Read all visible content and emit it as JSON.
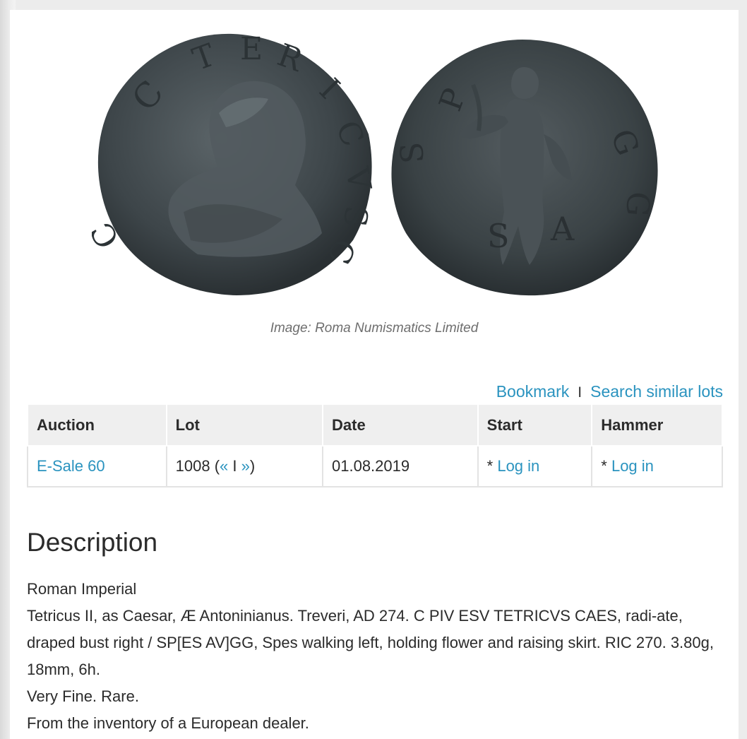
{
  "image": {
    "caption": "Image: Roma Numismatics Limited",
    "obverse_icon": "coin-obverse-bust",
    "reverse_icon": "coin-reverse-spes"
  },
  "actions": {
    "bookmark_label": "Bookmark",
    "separator": "I",
    "search_similar_label": "Search similar lots"
  },
  "table": {
    "headers": [
      "Auction",
      "Lot",
      "Date",
      "Start",
      "Hammer"
    ],
    "row": {
      "auction": "E-Sale 60",
      "lot_number": "1008",
      "lot_prev": "«",
      "lot_sep": "I",
      "lot_next": "»",
      "date": "01.08.2019",
      "start_prefix": "* ",
      "start_link": "Log in",
      "hammer_prefix": "* ",
      "hammer_link": "Log in"
    }
  },
  "description": {
    "title": "Description",
    "lines": [
      "Roman Imperial",
      "Tetricus II, as Caesar, Æ Antoninianus. Treveri, AD 274. C PIV ESV TETRICVS CAES, radi-ate, draped bust right / SP[ES AV]GG, Spes walking left, holding flower and raising skirt. RIC 270. 3.80g, 18mm, 6h.",
      "Very Fine. Rare.",
      "From the inventory of a European dealer."
    ]
  },
  "colors": {
    "link": "#2a93bf",
    "header_bg": "#efefef",
    "text": "#2b2b2b",
    "caption": "#6e6e6e"
  }
}
